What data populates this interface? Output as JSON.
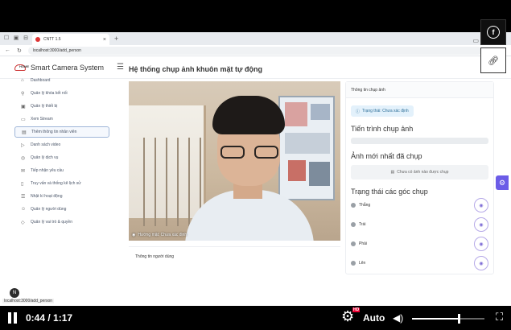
{
  "browser": {
    "tab_title": "CNTT 1.5",
    "url": "localhost:3000/add_person"
  },
  "app": {
    "brand": "Smart Camera System"
  },
  "sidebar": {
    "section": "HOME",
    "items": [
      {
        "label": "Dashboard",
        "icon": "home-icon",
        "active": false
      },
      {
        "label": "Quản lý khóa kết nối",
        "icon": "key-icon",
        "active": false
      },
      {
        "label": "Quản lý thiết bị",
        "icon": "camera-icon",
        "active": false
      },
      {
        "label": "Xem Stream",
        "icon": "stream-icon",
        "active": false
      },
      {
        "label": "Thêm thông tin nhân viên",
        "icon": "id-card-icon",
        "active": true
      },
      {
        "label": "Danh sách video",
        "icon": "video-list-icon",
        "active": false
      },
      {
        "label": "Quản lý dịch vụ",
        "icon": "service-icon",
        "active": false
      },
      {
        "label": "Tiếp nhận yêu cầu",
        "icon": "inbox-icon",
        "active": false
      },
      {
        "label": "Truy vấn và thống kê lịch sử",
        "icon": "document-icon",
        "active": false
      },
      {
        "label": "Nhật kí hoạt động",
        "icon": "log-icon",
        "active": false
      },
      {
        "label": "Quản lý người dùng",
        "icon": "user-icon",
        "active": false
      },
      {
        "label": "Quản lý vai trò & quyền",
        "icon": "shield-icon",
        "active": false
      }
    ]
  },
  "main": {
    "title": "Hệ thống chụp ảnh khuôn mặt tự động",
    "video_overlay": "Hướng mặt: Chưa xác định",
    "info_card_title": "Thông tin người dùng"
  },
  "panel": {
    "header": "Thông tin chụp ảnh",
    "status": "Trạng thái: Chưa xác định",
    "progress_title": "Tiến trình chụp ảnh",
    "progress": 0,
    "latest_title": "Ảnh mới nhất đã chụp",
    "no_image": "Chưa có ảnh nào được chụp",
    "angles_title": "Trạng thái các góc chụp",
    "angles": [
      "Thẳng",
      "Trái",
      "Phải",
      "Lên"
    ]
  },
  "player": {
    "current_time": "0:44",
    "duration": "1:17",
    "quality": "Auto",
    "hd_badge": "HD",
    "volume": 0.65
  },
  "overlay": {
    "avatar_letter": "N",
    "status_url": "localhost:3000/add_person"
  },
  "share": {
    "facebook_glyph": "f"
  }
}
